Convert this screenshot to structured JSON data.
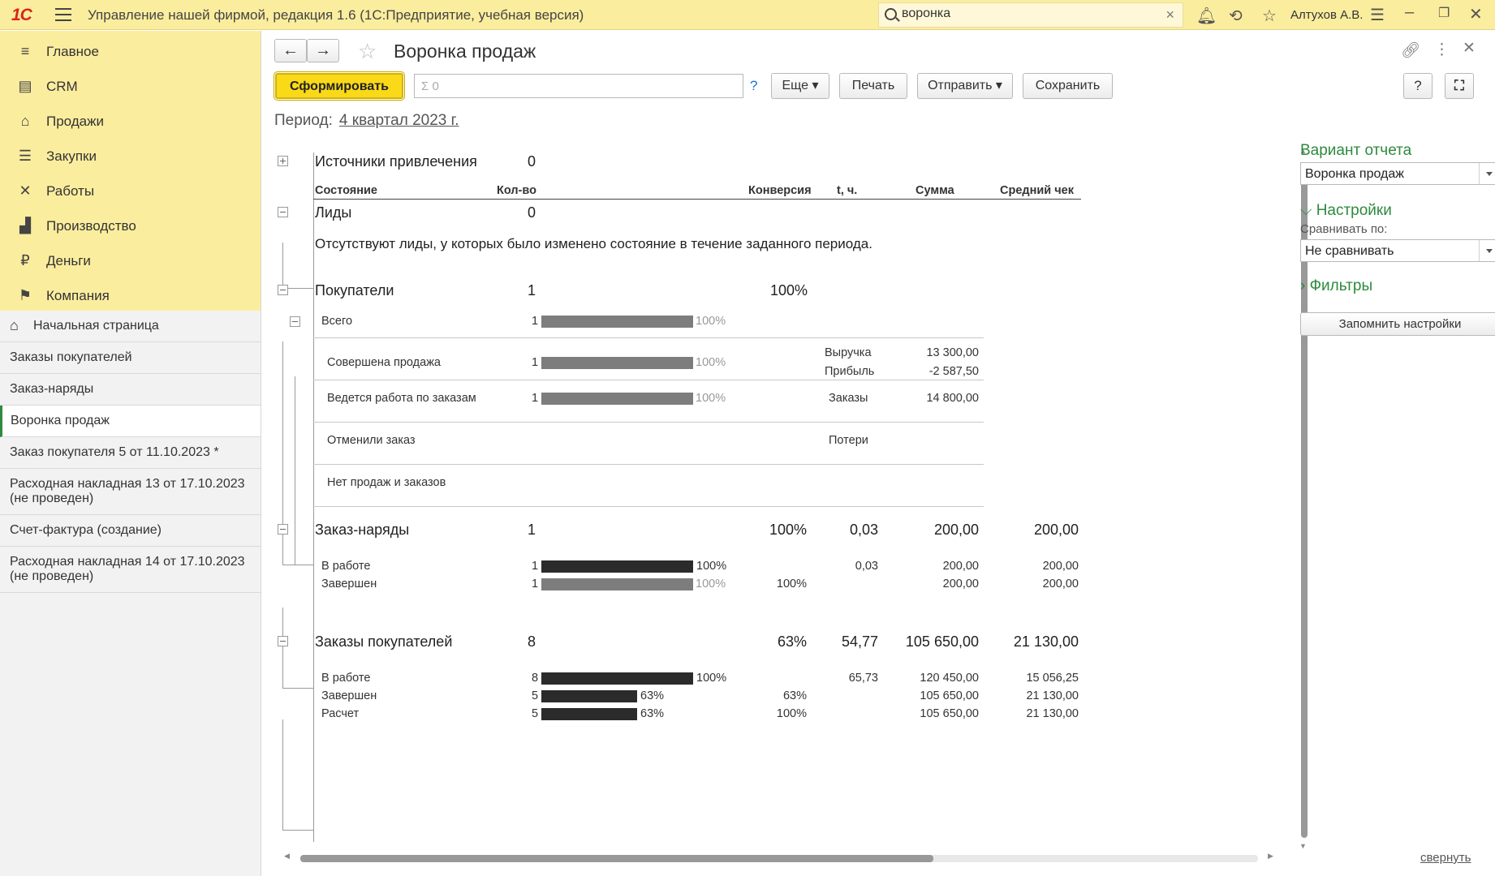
{
  "app": {
    "logo": "1С",
    "title": "Управление нашей фирмой, редакция 1.6  (1С:Предприятие, учебная версия)",
    "search_value": "воронка",
    "user": "Алтухов А.В."
  },
  "sidebar": {
    "items": [
      {
        "label": "Главное",
        "icon": "≡"
      },
      {
        "label": "CRM",
        "icon": "▤"
      },
      {
        "label": "Продажи",
        "icon": "⌂"
      },
      {
        "label": "Закупки",
        "icon": "☰"
      },
      {
        "label": "Работы",
        "icon": "✕"
      },
      {
        "label": "Производство",
        "icon": "▟"
      },
      {
        "label": "Деньги",
        "icon": "₽"
      },
      {
        "label": "Компания",
        "icon": "⚑"
      }
    ],
    "open": [
      "Начальная страница",
      "Заказы покупателей",
      "Заказ-наряды",
      "Воронка продаж",
      "Заказ покупателя 5 от 11.10.2023 *",
      "Расходная накладная 13 от 17.10.2023 (не проведен)",
      "Счет-фактура (создание)",
      "Расходная накладная 14 от 17.10.2023 (не проведен)"
    ]
  },
  "form": {
    "title": "Воронка продаж",
    "generate_label": "Сформировать",
    "sum_placeholder": "Σ 0",
    "help": "?",
    "more_label": "Еще",
    "print_label": "Печать",
    "send_label": "Отправить",
    "save_label": "Сохранить",
    "help_button": "?",
    "period_label": "Период:",
    "period_value": "4 квартал 2023 г.",
    "collapse_label": "свернуть"
  },
  "report": {
    "sources": {
      "label": "Источники привлечения",
      "count": "0"
    },
    "headers": {
      "state": "Состояние",
      "qty": "Кол-во",
      "conv": "Конверсия",
      "t": "t, ч.",
      "sum": "Сумма",
      "avg": "Средний чек"
    },
    "leads": {
      "label": "Лиды",
      "count": "0",
      "message": "Отсутствуют лиды, у которых было изменено состояние в течение заданного периода."
    },
    "buyers": {
      "label": "Покупатели",
      "count": "1",
      "conv": "100%",
      "total": {
        "label": "Всего",
        "count": "1",
        "pct": "100%",
        "fill": 1.0
      },
      "rows": [
        {
          "label": "Совершена продажа",
          "count": "1",
          "pct": "100%",
          "fill": 1.0,
          "k1": "Выручка",
          "v1": "13 300,00",
          "k2": "Прибыль",
          "v2": "-2 587,50"
        },
        {
          "label": "Ведется работа по заказам",
          "count": "1",
          "pct": "100%",
          "fill": 1.0,
          "k1": "Заказы",
          "v1": "14 800,00"
        },
        {
          "label": "Отменили заказ",
          "k1": "Потери"
        },
        {
          "label": "Нет продаж и заказов"
        }
      ]
    },
    "work_orders": {
      "label": "Заказ-наряды",
      "count": "1",
      "conv": "100%",
      "t": "0,03",
      "sum": "200,00",
      "avg": "200,00",
      "rows": [
        {
          "label": "В работе",
          "count": "1",
          "pct": "100%",
          "fill": 1.0,
          "conv": "",
          "t": "0,03",
          "sum": "200,00",
          "avg": "200,00"
        },
        {
          "label": "Завершен",
          "count": "1",
          "pct": "100%",
          "fill": 1.0,
          "conv": "100%",
          "t": "",
          "sum": "200,00",
          "avg": "200,00"
        }
      ]
    },
    "customer_orders": {
      "label": "Заказы покупателей",
      "count": "8",
      "conv": "63%",
      "t": "54,77",
      "sum": "105 650,00",
      "avg": "21 130,00",
      "rows": [
        {
          "label": "В работе",
          "count": "8",
          "pct": "100%",
          "fill": 1.0,
          "conv": "",
          "t": "65,73",
          "sum": "120 450,00",
          "avg": "15 056,25"
        },
        {
          "label": "Завершен",
          "count": "5",
          "pct": "63%",
          "fill": 0.63,
          "conv": "63%",
          "t": "",
          "sum": "105 650,00",
          "avg": "21 130,00"
        },
        {
          "label": "Расчет",
          "count": "5",
          "pct": "63%",
          "fill": 0.63,
          "conv": "100%",
          "t": "",
          "sum": "105 650,00",
          "avg": "21 130,00"
        }
      ]
    }
  },
  "settings_panel": {
    "variant_title": "Вариант отчета",
    "variant_value": "Воронка продаж",
    "settings_title": "Настройки",
    "compare_label": "Сравнивать по:",
    "compare_value": "Не сравнивать",
    "filters_title": "Фильтры",
    "remember_label": "Запомнить настройки"
  }
}
